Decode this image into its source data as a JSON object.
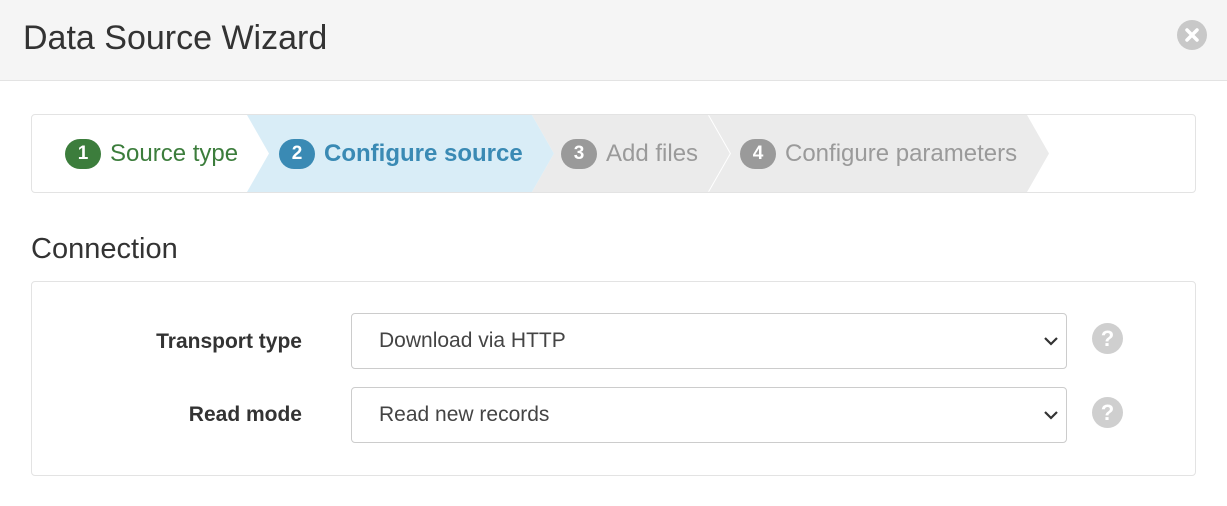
{
  "dialog": {
    "title": "Data Source Wizard"
  },
  "steps": [
    {
      "number": "1",
      "label": "Source type",
      "state": "completed"
    },
    {
      "number": "2",
      "label": "Configure source",
      "state": "active"
    },
    {
      "number": "3",
      "label": "Add files",
      "state": "pending"
    },
    {
      "number": "4",
      "label": "Configure parameters",
      "state": "pending"
    }
  ],
  "connection": {
    "heading": "Connection",
    "transport_type": {
      "label": "Transport type",
      "value": "Download via HTTP"
    },
    "read_mode": {
      "label": "Read mode",
      "value": "Read new records"
    },
    "help_glyph": "?"
  },
  "colors": {
    "completed": "#3c7d3c",
    "active": "#3a8ab4",
    "active_bg": "#d9edf7",
    "pending": "#9a9a9a",
    "pending_bg": "#ebebeb"
  },
  "icons": {
    "close": "close-icon",
    "dropdown": "chevron-down-icon",
    "help": "question-icon"
  }
}
